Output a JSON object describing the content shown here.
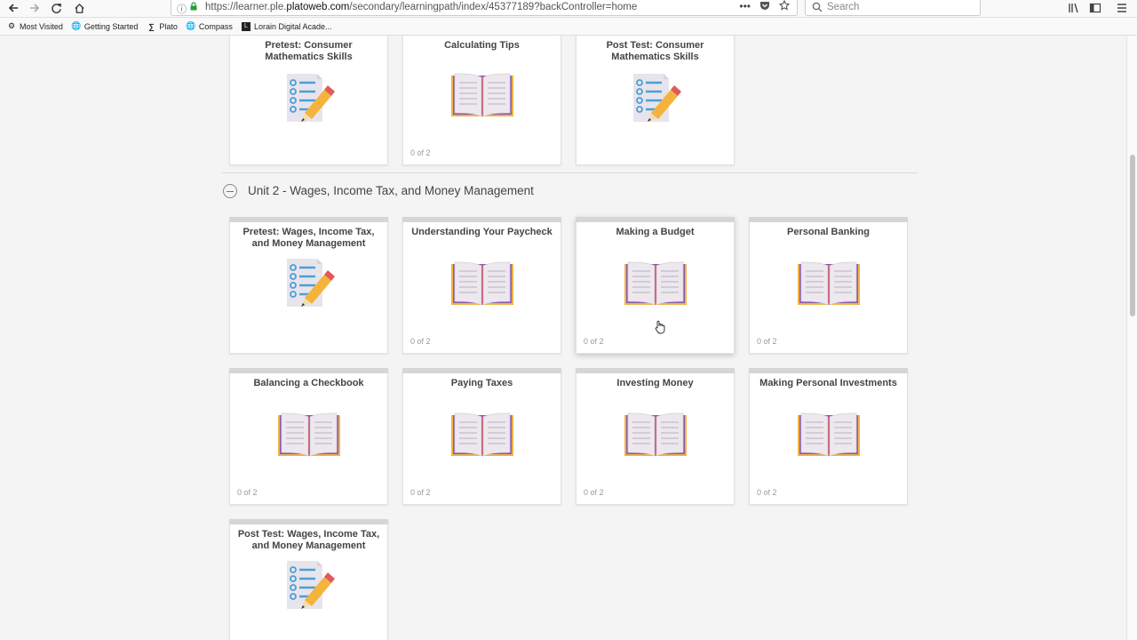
{
  "browser": {
    "url_prefix": "https://learner.ple.",
    "url_domain": "platoweb.com",
    "url_path": "/secondary/learningpath/index/45377189?backController=home",
    "url_actions": "•••",
    "search_placeholder": "Search",
    "bookmarks": [
      {
        "label": "Most Visited",
        "icon": "gear-icon"
      },
      {
        "label": "Getting Started",
        "icon": "globe-icon"
      },
      {
        "label": "Plato",
        "icon": "plato-icon"
      },
      {
        "label": "Compass",
        "icon": "globe-icon"
      },
      {
        "label": "Lorain Digital Acade...",
        "icon": "school-icon"
      }
    ]
  },
  "unit1": {
    "cards": [
      {
        "title": "Pretest: Consumer Mathematics Skills",
        "icon": "checklist-pencil-icon",
        "progress": ""
      },
      {
        "title": "Calculating Tips",
        "icon": "open-book-icon",
        "progress": "0 of 2"
      },
      {
        "title": "Post Test: Consumer Mathematics Skills",
        "icon": "checklist-pencil-icon",
        "progress": ""
      }
    ]
  },
  "unit2": {
    "title": "Unit 2 - Wages, Income Tax, and Money Management",
    "cards": [
      {
        "title": "Pretest: Wages, Income Tax, and Money Management",
        "icon": "checklist-pencil-icon",
        "progress": ""
      },
      {
        "title": "Understanding Your Paycheck",
        "icon": "open-book-icon",
        "progress": "0 of 2"
      },
      {
        "title": "Making a Budget",
        "icon": "open-book-icon",
        "progress": "0 of 2"
      },
      {
        "title": "Personal Banking",
        "icon": "open-book-icon",
        "progress": "0 of 2"
      },
      {
        "title": "Balancing a Checkbook",
        "icon": "open-book-icon",
        "progress": "0 of 2"
      },
      {
        "title": "Paying Taxes",
        "icon": "open-book-icon",
        "progress": "0 of 2"
      },
      {
        "title": "Investing Money",
        "icon": "open-book-icon",
        "progress": "0 of 2"
      },
      {
        "title": "Making Personal Investments",
        "icon": "open-book-icon",
        "progress": "0 of 2"
      },
      {
        "title": "Post Test: Wages, Income Tax, and Money Management",
        "icon": "checklist-pencil-icon",
        "progress": ""
      }
    ]
  },
  "colors": {
    "book_cover": "#f0b444",
    "book_spine": "#e05a5a",
    "book_edge": "#8e5aa8",
    "book_page": "#ece8ee",
    "checklist_paper": "#e8e4ec",
    "checklist_blue": "#4a9fd8",
    "pencil": "#f3b33d"
  }
}
